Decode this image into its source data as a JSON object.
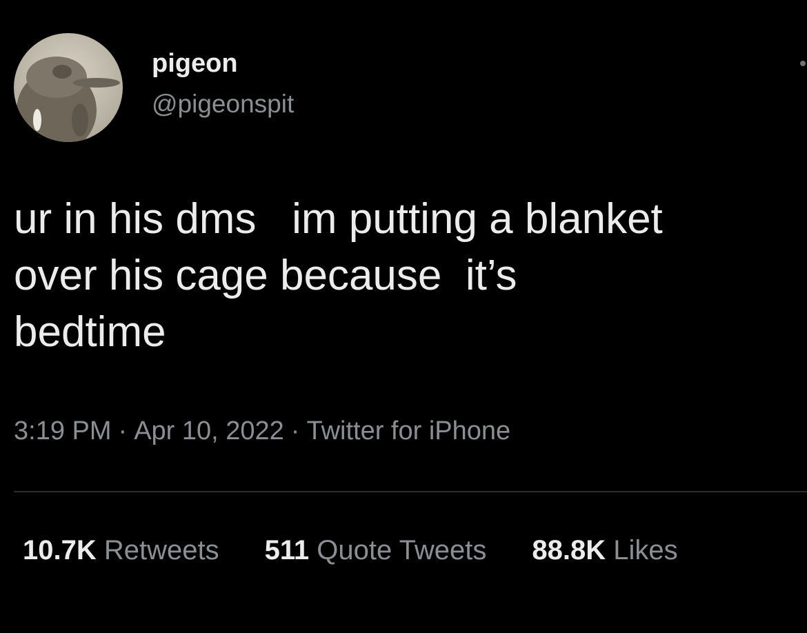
{
  "user": {
    "display_name": "pigeon",
    "handle": "@pigeonspit"
  },
  "tweet": {
    "text": "ur in his dms   im putting a blanket\nover his cage because  it’s\nbedtime",
    "time": "3:19 PM",
    "date": "Apr 10, 2022",
    "source": "Twitter for iPhone",
    "separator": "·"
  },
  "stats": {
    "retweets_count": "10.7K",
    "retweets_label": "Retweets",
    "quote_count": "511",
    "quote_label": "Quote Tweets",
    "likes_count": "88.8K",
    "likes_label": "Likes"
  },
  "icons": {
    "avatar": "pigeon-avatar-icon",
    "more": "more-options-icon"
  },
  "colors": {
    "background": "#000000",
    "primary_text": "#ececec",
    "secondary_text": "#8b8f94",
    "divider": "#2a2d30"
  }
}
